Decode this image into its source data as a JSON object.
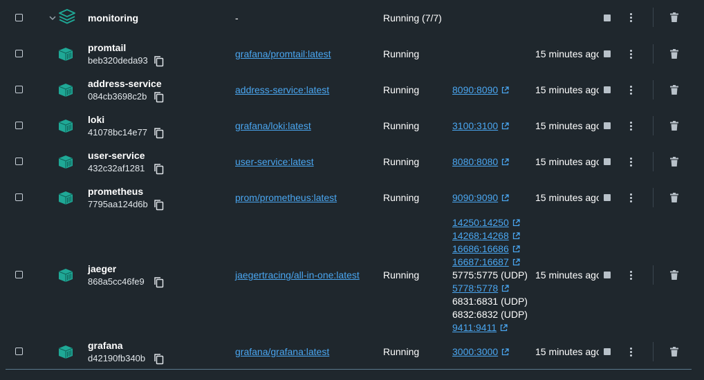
{
  "group": {
    "name": "monitoring",
    "image": "-",
    "status": "Running (7/7)"
  },
  "containers": [
    {
      "name": "promtail",
      "id": "beb320deda93",
      "image": "grafana/promtail:latest",
      "status": "Running",
      "ports": [],
      "time": "15 minutes ago"
    },
    {
      "name": "address-service",
      "id": "084cb3698c2b",
      "image": "address-service:latest",
      "status": "Running",
      "ports": [
        {
          "label": "8090:8090",
          "link": true
        }
      ],
      "time": "15 minutes ago"
    },
    {
      "name": "loki",
      "id": "41078bc14e77",
      "image": "grafana/loki:latest",
      "status": "Running",
      "ports": [
        {
          "label": "3100:3100",
          "link": true
        }
      ],
      "time": "15 minutes ago"
    },
    {
      "name": "user-service",
      "id": "432c32af1281",
      "image": "user-service:latest",
      "status": "Running",
      "ports": [
        {
          "label": "8080:8080",
          "link": true
        }
      ],
      "time": "15 minutes ago"
    },
    {
      "name": "prometheus",
      "id": "7795aa124d6b",
      "image": "prom/prometheus:latest",
      "status": "Running",
      "ports": [
        {
          "label": "9090:9090",
          "link": true
        }
      ],
      "time": "15 minutes ago"
    },
    {
      "name": "jaeger",
      "id": "868a5cc46fe9",
      "image": "jaegertracing/all-in-one:latest",
      "status": "Running",
      "ports": [
        {
          "label": "14250:14250",
          "link": true
        },
        {
          "label": "14268:14268",
          "link": true
        },
        {
          "label": "16686:16686",
          "link": true
        },
        {
          "label": "16687:16687",
          "link": true
        },
        {
          "label": "5775:5775 (UDP)",
          "link": false
        },
        {
          "label": "5778:5778",
          "link": true
        },
        {
          "label": "6831:6831 (UDP)",
          "link": false
        },
        {
          "label": "6832:6832 (UDP)",
          "link": false
        },
        {
          "label": "9411:9411",
          "link": true
        }
      ],
      "time": "15 minutes ago"
    },
    {
      "name": "grafana",
      "id": "d42190fb340b",
      "image": "grafana/grafana:latest",
      "status": "Running",
      "ports": [
        {
          "label": "3000:3000",
          "link": true
        }
      ],
      "time": "15 minutes ago"
    }
  ],
  "colors": {
    "background": "#1f272d",
    "link": "#4aa6f0",
    "icon_teal": "#1fa896"
  },
  "icons": {
    "group": "stack-icon",
    "container": "container-icon",
    "copy": "copy-icon",
    "external": "external-link-icon",
    "stop": "stop-icon",
    "more": "kebab-menu-icon",
    "delete": "trash-icon",
    "expand": "chevron-down-icon"
  }
}
